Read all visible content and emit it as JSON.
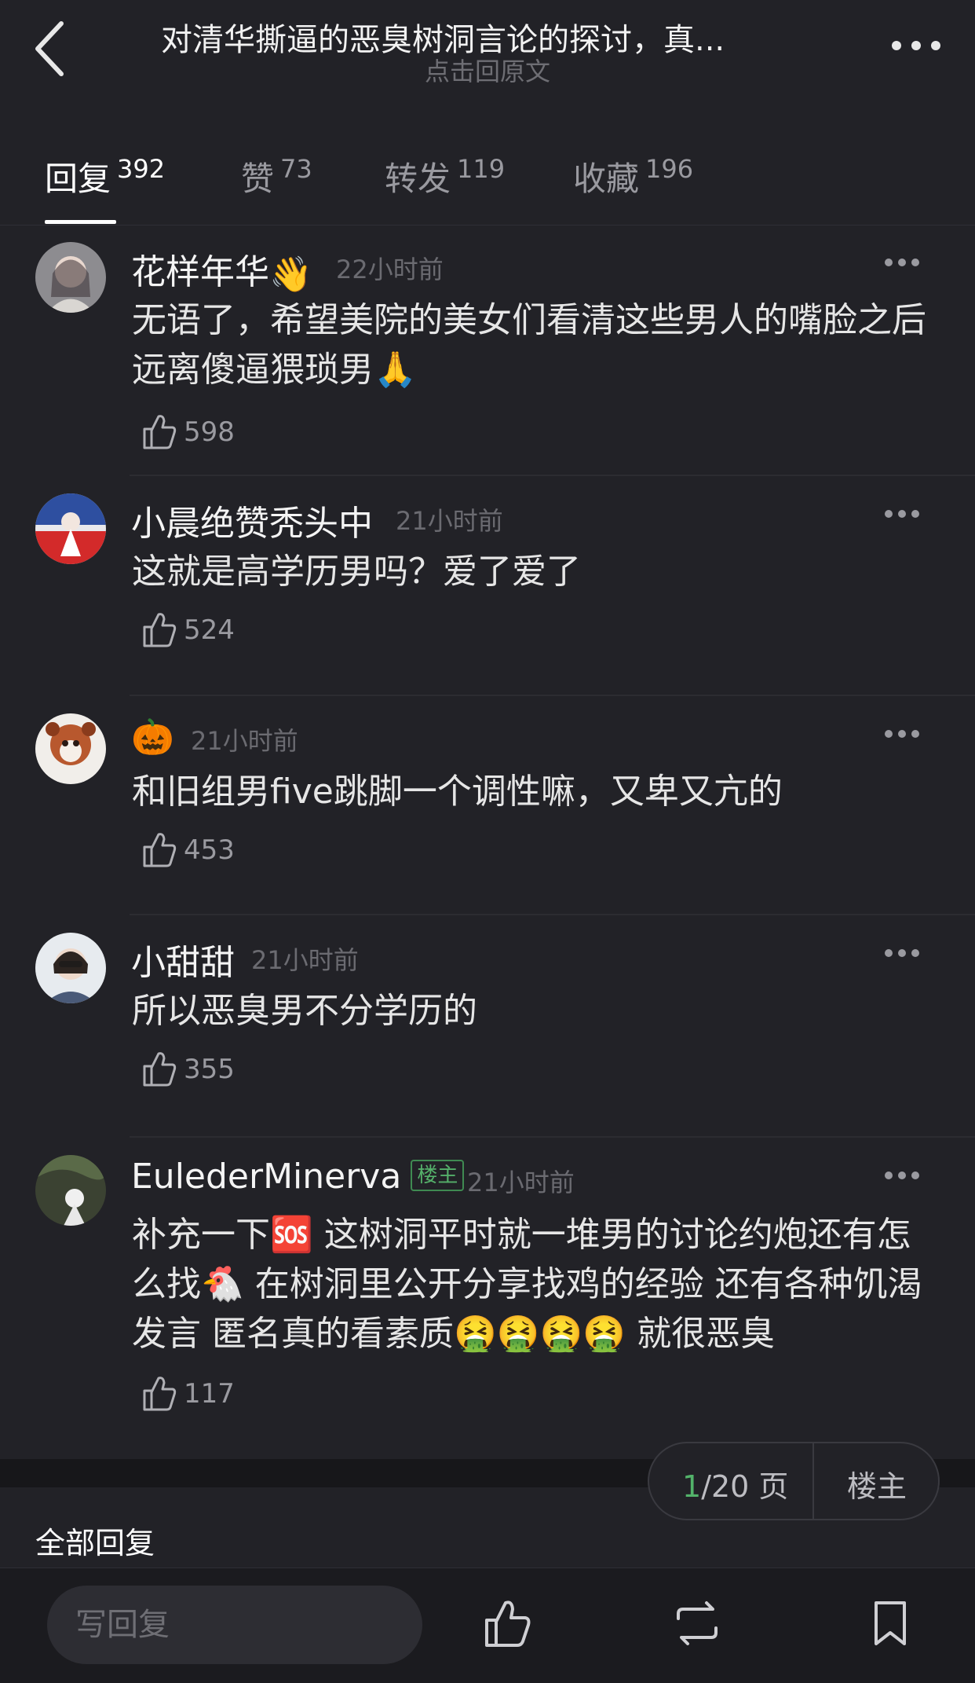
{
  "header": {
    "title": "对清华撕逼的恶臭树洞言论的探讨，真...",
    "subtitle": "点击回原文",
    "back_icon": "back-arrow-icon",
    "more_icon": "more-dots-icon"
  },
  "tabs": [
    {
      "label": "回复",
      "count": "392",
      "active": true
    },
    {
      "label": "赞",
      "count": "73",
      "active": false
    },
    {
      "label": "转发",
      "count": "119",
      "active": false
    },
    {
      "label": "收藏",
      "count": "196",
      "active": false
    }
  ],
  "comments": [
    {
      "username": "花样年华",
      "emoji": "👋",
      "time": "22小时前",
      "text": "无语了，希望美院的美女们看清这些男人的嘴脸之后远离傻逼猥琐男🙏",
      "likes": "598"
    },
    {
      "username": "小晨绝赞秃头中",
      "time": "21小时前",
      "text": "这就是高学历男吗？爱了爱了",
      "likes": "524"
    },
    {
      "username": "",
      "emoji": "🎃",
      "time": "21小时前",
      "text": "和旧组男five跳脚一个调性嘛，又卑又亢的",
      "likes": "453"
    },
    {
      "username": "小甜甜",
      "time": "21小时前",
      "text": "所以恶臭男不分学历的",
      "likes": "355"
    },
    {
      "username": "EulederMinerva",
      "op_tag": "楼主",
      "time": "21小时前",
      "text": "补充一下🆘 这树洞平时就一堆男的讨论约炮还有怎么找🐔 在树洞里公开分享找鸡的经验 还有各种饥渴发言 匿名真的看素质🤮🤮🤮🤮 就很恶臭",
      "likes": "117"
    }
  ],
  "pager": {
    "current": "1",
    "total": "/20 页",
    "op_label": "楼主"
  },
  "section": {
    "all_replies": "全部回复"
  },
  "bottom_bar": {
    "reply_placeholder": "写回复",
    "icons": [
      "like-icon",
      "repost-icon",
      "bookmark-icon"
    ]
  },
  "colors": {
    "background": "#222227",
    "accent_green": "#53b36a",
    "muted": "#6b6b71"
  }
}
